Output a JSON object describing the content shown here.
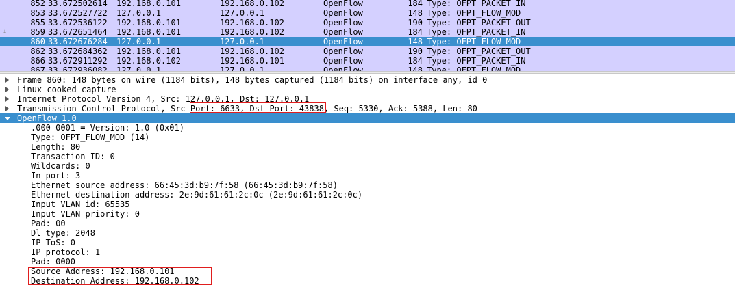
{
  "packet_list": {
    "rows": [
      {
        "no": "852",
        "time": "33.672502614",
        "src": "192.168.0.101",
        "dst": "192.168.0.102",
        "proto": "OpenFlow",
        "len": "184",
        "info": "Type: OFPT_PACKET_IN",
        "selected": false
      },
      {
        "no": "853",
        "time": "33.672527722",
        "src": "127.0.0.1",
        "dst": "127.0.0.1",
        "proto": "OpenFlow",
        "len": "148",
        "info": "Type: OFPT_FLOW_MOD",
        "selected": false
      },
      {
        "no": "855",
        "time": "33.672536122",
        "src": "192.168.0.101",
        "dst": "192.168.0.102",
        "proto": "OpenFlow",
        "len": "190",
        "info": "Type: OFPT_PACKET_OUT",
        "selected": false
      },
      {
        "no": "859",
        "time": "33.672651464",
        "src": "192.168.0.101",
        "dst": "192.168.0.102",
        "proto": "OpenFlow",
        "len": "184",
        "info": "Type: OFPT_PACKET_IN",
        "selected": false
      },
      {
        "no": "860",
        "time": "33.672676284",
        "src": "127.0.0.1",
        "dst": "127.0.0.1",
        "proto": "OpenFlow",
        "len": "148",
        "info": "Type: OFPT_FLOW_MOD",
        "selected": true
      },
      {
        "no": "862",
        "time": "33.672684362",
        "src": "192.168.0.101",
        "dst": "192.168.0.102",
        "proto": "OpenFlow",
        "len": "190",
        "info": "Type: OFPT_PACKET_OUT",
        "selected": false
      },
      {
        "no": "866",
        "time": "33.672911292",
        "src": "192.168.0.102",
        "dst": "192.168.0.101",
        "proto": "OpenFlow",
        "len": "184",
        "info": "Type: OFPT_PACKET_IN",
        "selected": false
      },
      {
        "no": "867",
        "time": "33.672936082",
        "src": "127.0.0.1",
        "dst": "127.0.0.1",
        "proto": "OpenFlow",
        "len": "148",
        "info": "Type: OFPT_FLOW_MOD",
        "selected": false
      }
    ],
    "row_color": "#d4d0ff",
    "selected_color": "#3a8fce"
  },
  "detail": {
    "lines": [
      {
        "text": "Frame 860: 148 bytes on wire (1184 bits), 148 bytes captured (1184 bits) on interface any, id 0",
        "level": 0,
        "expander": "collapsed",
        "selected": false
      },
      {
        "text": "Linux cooked capture",
        "level": 0,
        "expander": "collapsed",
        "selected": false
      },
      {
        "text": "Internet Protocol Version 4, Src: 127.0.0.1, Dst: 127.0.0.1",
        "level": 0,
        "expander": "collapsed",
        "selected": false
      },
      {
        "text": "Transmission Control Protocol, Src Port: 6633, Dst Port: 43838, Seq: 5330, Ack: 5388, Len: 80",
        "level": 0,
        "expander": "collapsed",
        "selected": false
      },
      {
        "text": "OpenFlow 1.0",
        "level": 0,
        "expander": "expanded",
        "selected": true
      },
      {
        "text": ".000 0001 = Version: 1.0 (0x01)",
        "level": 1,
        "expander": "none",
        "selected": false
      },
      {
        "text": "Type: OFPT_FLOW_MOD (14)",
        "level": 1,
        "expander": "none",
        "selected": false
      },
      {
        "text": "Length: 80",
        "level": 1,
        "expander": "none",
        "selected": false
      },
      {
        "text": "Transaction ID: 0",
        "level": 1,
        "expander": "none",
        "selected": false
      },
      {
        "text": "Wildcards: 0",
        "level": 1,
        "expander": "none",
        "selected": false
      },
      {
        "text": "In port: 3",
        "level": 1,
        "expander": "none",
        "selected": false
      },
      {
        "text": "Ethernet source address: 66:45:3d:b9:7f:58 (66:45:3d:b9:7f:58)",
        "level": 1,
        "expander": "none",
        "selected": false
      },
      {
        "text": "Ethernet destination address: 2e:9d:61:61:2c:0c (2e:9d:61:61:2c:0c)",
        "level": 1,
        "expander": "none",
        "selected": false
      },
      {
        "text": "Input VLAN id: 65535",
        "level": 1,
        "expander": "none",
        "selected": false
      },
      {
        "text": "Input VLAN priority: 0",
        "level": 1,
        "expander": "none",
        "selected": false
      },
      {
        "text": "Pad: 00",
        "level": 1,
        "expander": "none",
        "selected": false
      },
      {
        "text": "Dl type: 2048",
        "level": 1,
        "expander": "none",
        "selected": false
      },
      {
        "text": "IP ToS: 0",
        "level": 1,
        "expander": "none",
        "selected": false
      },
      {
        "text": "IP protocol: 1",
        "level": 1,
        "expander": "none",
        "selected": false
      },
      {
        "text": "Pad: 0000",
        "level": 1,
        "expander": "none",
        "selected": false
      },
      {
        "text": "Source Address: 192.168.0.101",
        "level": 1,
        "expander": "none",
        "selected": false
      },
      {
        "text": "Destination Address: 192.168.0.102",
        "level": 1,
        "expander": "none",
        "selected": false
      }
    ],
    "highlight_color": "#e01e1e"
  }
}
